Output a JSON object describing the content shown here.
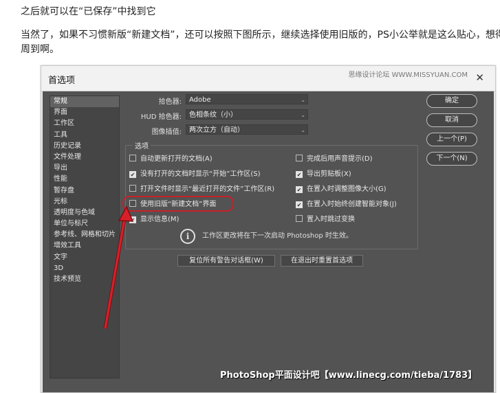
{
  "article": {
    "line1": "之后就可以在“已保存”中找到它",
    "line2": "当然了，如果不习惯新版“新建文档”，还可以按照下图所示，继续选择使用旧版的，PS小公举就是这么贴心，想得",
    "line3": "周到啊。"
  },
  "dialog": {
    "title": "首选项",
    "watermark_top": "思缘设计论坛 WWW.MISSYUAN.COM",
    "close_glyph": "✕",
    "sidebar": [
      "常规",
      "界面",
      "工作区",
      "工具",
      "历史记录",
      "文件处理",
      "导出",
      "性能",
      "暂存盘",
      "光标",
      "透明度与色域",
      "单位与标尺",
      "参考线、网格和切片",
      "增效工具",
      "文字",
      "3D",
      "技术预览"
    ],
    "selected_sidebar": "常规",
    "fields": {
      "color_picker_label": "拾色器:",
      "color_picker_value": "Adobe",
      "hud_label": "HUD 拾色器:",
      "hud_value": "色相条纹（小）",
      "interp_label": "图像插值:",
      "interp_value": "两次立方（自动）"
    },
    "options_title": "选项",
    "options_left": [
      {
        "label": "自动更新打开的文档(A)",
        "checked": false
      },
      {
        "label": "没有打开的文档时显示“开始”工作区(S)",
        "checked": true
      },
      {
        "label": "打开文件时显示“最近打开的文件”工作区(R)",
        "checked": false
      },
      {
        "label": "使用旧版“新建文档”界面",
        "checked": false
      },
      {
        "label": "显示信息(M)",
        "checked": true
      }
    ],
    "options_right": [
      {
        "label": "完成后用声音提示(D)",
        "checked": false
      },
      {
        "label": "导出剪贴板(X)",
        "checked": true
      },
      {
        "label": "在置入时调整图像大小(G)",
        "checked": true
      },
      {
        "label": "在置入时始终创建智能对象(J)",
        "checked": true
      },
      {
        "label": "置入时跳过变换",
        "checked": false
      }
    ],
    "info_text": "工作区更改将在下一次启动 Photoshop 时生效。",
    "buttons": {
      "ok": "确定",
      "cancel": "取消",
      "prev": "上一个(P)",
      "next": "下一个(N)",
      "reset_warnings": "复位所有警告对话框(W)",
      "reset_on_quit": "在退出时重置首选项"
    },
    "watermark_bottom": "PhotoShop平面设计吧【www.linecg.com/tieba/1783】"
  },
  "colors": {
    "panel": "#535353",
    "highlight": "#c8202a"
  }
}
